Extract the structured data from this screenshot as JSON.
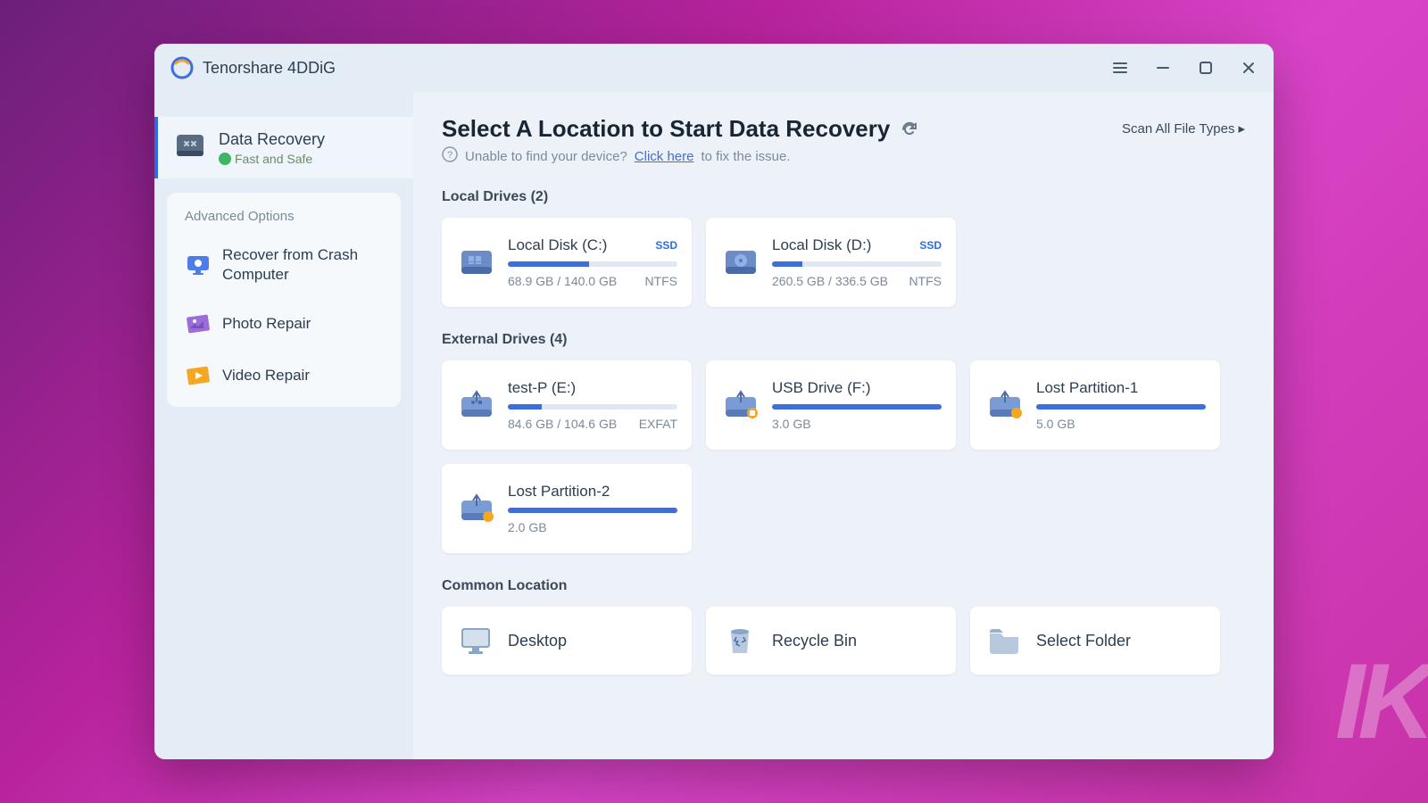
{
  "app": {
    "title": "Tenorshare 4DDiG"
  },
  "window_controls": {
    "menu": "≡",
    "min": "—",
    "max": "☐",
    "close": "✕"
  },
  "sidebar": {
    "data_recovery": {
      "label": "Data Recovery",
      "sub": "Fast and Safe"
    },
    "advanced_header": "Advanced Options",
    "items": [
      {
        "label": "Recover from Crash Computer"
      },
      {
        "label": "Photo Repair"
      },
      {
        "label": "Video Repair"
      }
    ]
  },
  "main": {
    "title": "Select A Location to Start Data Recovery",
    "scan_all": "Scan All File Types",
    "help_prefix": "Unable to find your device?",
    "help_link": "Click here",
    "help_suffix": "to fix the issue.",
    "local": {
      "title": "Local Drives (2)",
      "drives": [
        {
          "name": "Local Disk (C:)",
          "badge": "SSD",
          "size": "68.9 GB / 140.0 GB",
          "fs": "NTFS",
          "fill": 48
        },
        {
          "name": "Local Disk (D:)",
          "badge": "SSD",
          "size": "260.5 GB / 336.5 GB",
          "fs": "NTFS",
          "fill": 18
        }
      ]
    },
    "external": {
      "title": "External Drives (4)",
      "drives": [
        {
          "name": "test-P (E:)",
          "badge": "",
          "size": "84.6 GB / 104.6 GB",
          "fs": "EXFAT",
          "fill": 20
        },
        {
          "name": "USB Drive (F:)",
          "badge": "",
          "size": "3.0 GB",
          "fs": "",
          "fill": 100
        },
        {
          "name": "Lost Partition-1",
          "badge": "",
          "size": "5.0 GB",
          "fs": "",
          "fill": 100
        },
        {
          "name": "Lost Partition-2",
          "badge": "",
          "size": "2.0 GB",
          "fs": "",
          "fill": 100
        }
      ]
    },
    "common": {
      "title": "Common Location",
      "items": [
        {
          "label": "Desktop"
        },
        {
          "label": "Recycle Bin"
        },
        {
          "label": "Select Folder"
        }
      ]
    }
  }
}
